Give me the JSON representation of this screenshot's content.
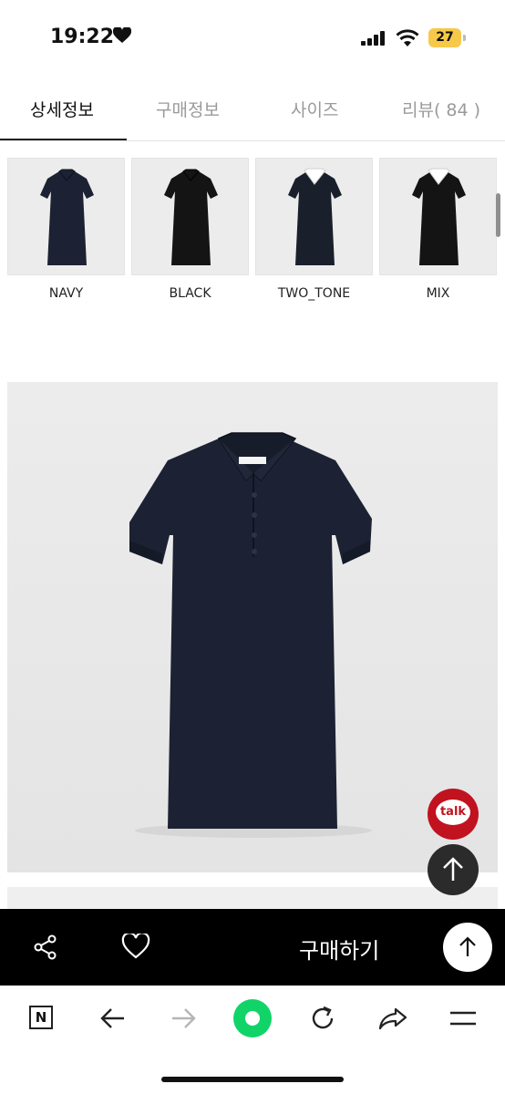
{
  "status": {
    "time": "19:22",
    "battery": "27",
    "heart_icon": "heart-icon",
    "signal_icon": "signal-icon",
    "wifi_icon": "wifi-icon"
  },
  "tabs": [
    {
      "label": "상세정보",
      "active": true
    },
    {
      "label": "구매정보",
      "active": false
    },
    {
      "label": "사이즈",
      "active": false
    },
    {
      "label": "리뷰( 84 )",
      "active": false
    }
  ],
  "colors_options": [
    {
      "label": "NAVY",
      "dress": "#1c2233",
      "collar": "#1c2233"
    },
    {
      "label": "BLACK",
      "dress": "#141414",
      "collar": "#141414"
    },
    {
      "label": "TWO_TONE",
      "dress": "#1a1f2c",
      "collar": "#ffffff"
    },
    {
      "label": "MIX",
      "dress": "#141414",
      "collar": "#ffffff"
    }
  ],
  "floating": {
    "talk_label": "talk"
  },
  "buybar": {
    "buy_label": "구매하기"
  },
  "theme": {
    "accent_green": "#11d468",
    "talk_red": "#c1121f",
    "dress_navy": "#1c2233"
  }
}
